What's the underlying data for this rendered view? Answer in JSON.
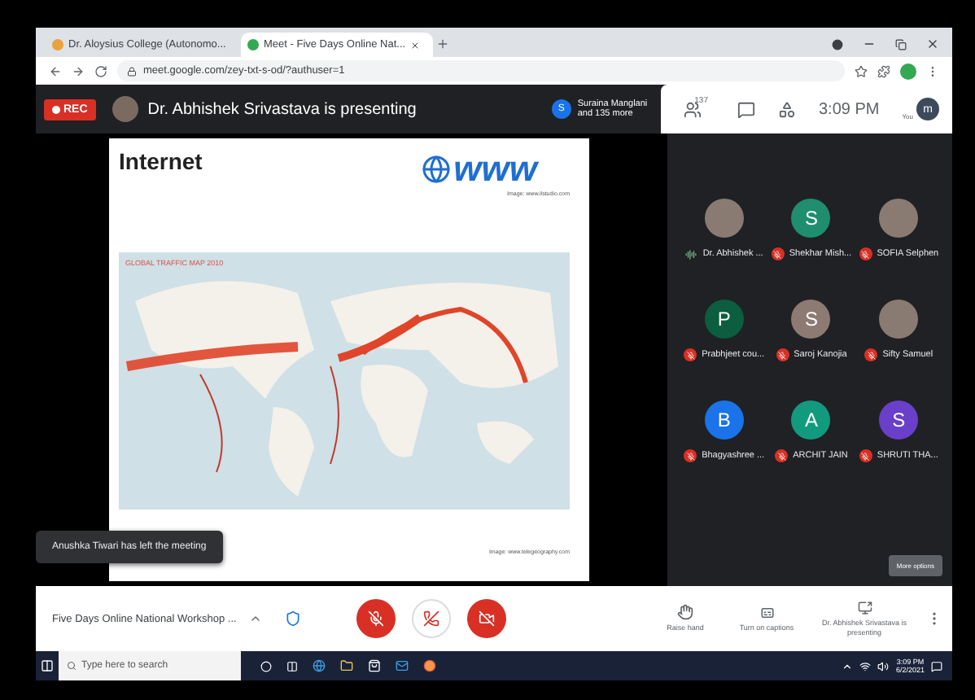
{
  "browser": {
    "tabs": [
      {
        "title": "Dr. Aloysius College (Autonomo...",
        "selected": false
      },
      {
        "title": "Meet - Five Days Online Nat...",
        "selected": true
      }
    ],
    "url": "meet.google.com/zey-txt-s-od/?authuser=1"
  },
  "top_bar": {
    "rec": "REC",
    "presenting": "Dr. Abhishek Srivastava is presenting",
    "speaker": {
      "initial": "S",
      "name": "Suraina Manglani",
      "more": "and 135 more"
    },
    "participant_count": "137",
    "time": "3:09 PM",
    "you": "You",
    "avatar": "m"
  },
  "slide": {
    "title": "Internet",
    "logo": "www",
    "credit_1": "Image: www.ilstudio.com",
    "map_title": "GLOBAL TRAFFIC MAP 2010",
    "credit_2": "Image: www.telegeography.com"
  },
  "toast": "Anushka Tiwari has left the meeting",
  "participants": [
    {
      "name": "Dr. Abhishek ...",
      "kind": "photo",
      "muted": false
    },
    {
      "name": "Shekhar Mish...",
      "kind": "initial",
      "initial": "S",
      "color": "#1e8e6e",
      "muted": true
    },
    {
      "name": "SOFIA Selphen",
      "kind": "photo",
      "muted": true
    },
    {
      "name": "Prabhjeet cou...",
      "kind": "initial",
      "initial": "P",
      "color": "#0b5e3f",
      "muted": true
    },
    {
      "name": "Saroj Kanojia",
      "kind": "initial",
      "initial": "S",
      "color": "#8d7a72",
      "muted": true
    },
    {
      "name": "Sifty Samuel",
      "kind": "photo",
      "muted": true
    },
    {
      "name": "Bhagyashree ...",
      "kind": "initial",
      "initial": "B",
      "color": "#1a73e8",
      "muted": true
    },
    {
      "name": "ARCHIT JAIN",
      "kind": "initial",
      "initial": "A",
      "color": "#129a7e",
      "muted": true
    },
    {
      "name": "SHRUTI THA...",
      "kind": "initial",
      "initial": "S",
      "color": "#6a3fc9",
      "muted": true
    }
  ],
  "more_options": "More options",
  "bottom_bar": {
    "meeting": "Five Days Online National Workshop ...",
    "mic_muted": true,
    "camera_off": true,
    "actions": [
      {
        "kind": "hand",
        "label": "Raise hand"
      },
      {
        "kind": "captions",
        "label": "Turn on captions"
      },
      {
        "kind": "present",
        "label": "Dr. Abhishek Srivastava is presenting"
      }
    ]
  },
  "taskbar": {
    "search_placeholder": "Type here to search",
    "time": "3:09 PM",
    "date": "6/2/2021"
  }
}
